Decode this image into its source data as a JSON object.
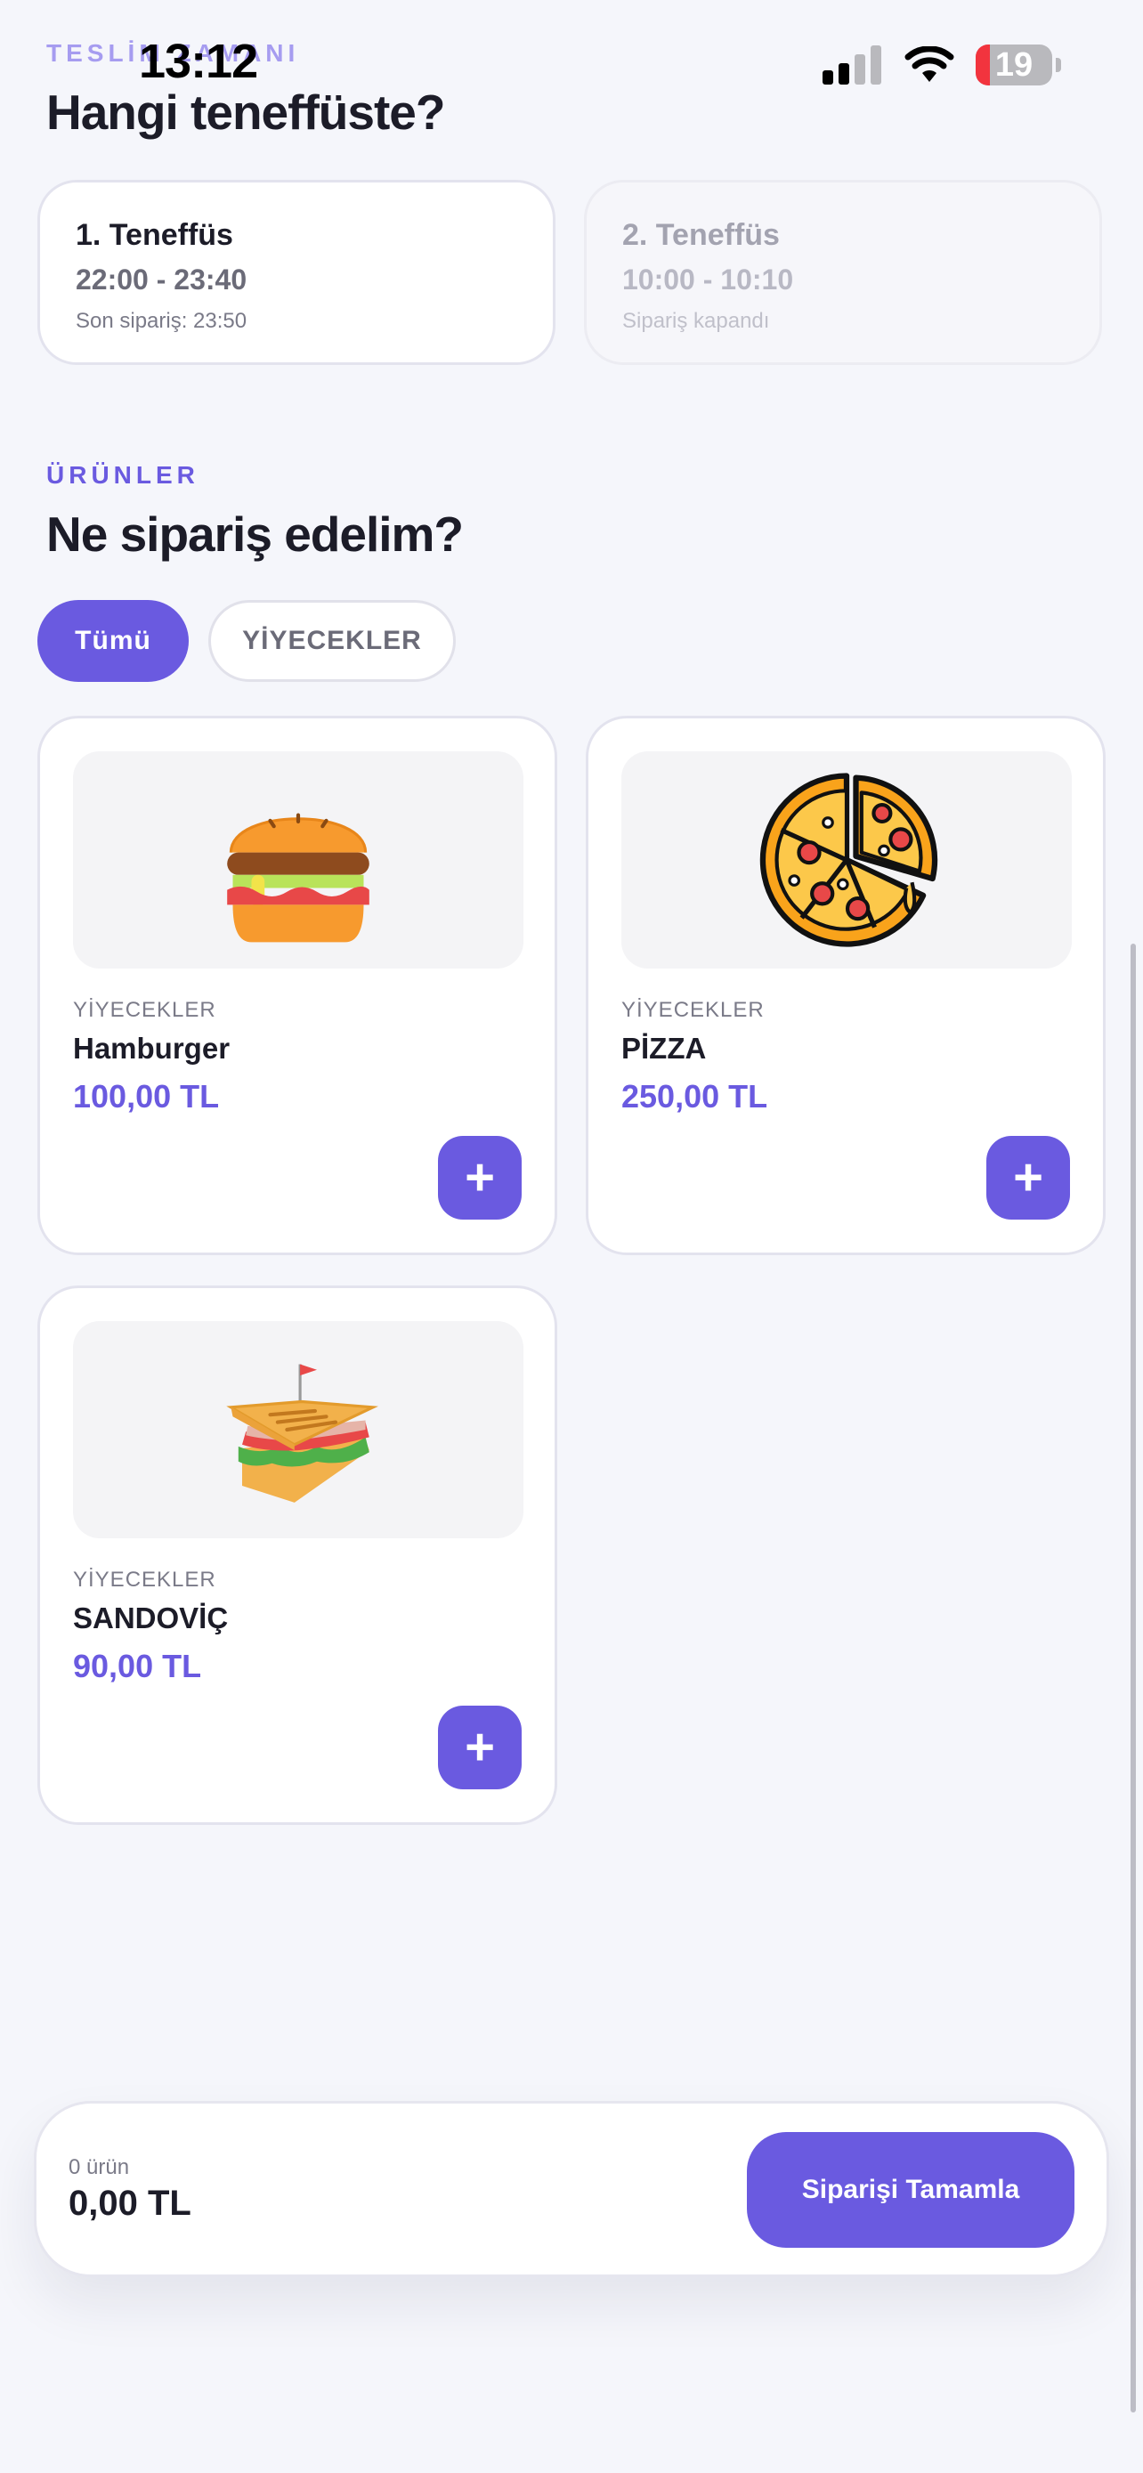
{
  "status_bar": {
    "time": "13:12",
    "battery": "19",
    "battery_level": 0.19
  },
  "delivery": {
    "label": "TESLİM ZAMANI",
    "title": "Hangi teneffüste?",
    "breaks": [
      {
        "name": "1. Teneffüs",
        "time": "22:00 - 23:40",
        "note": "Son sipariş: 23:50",
        "enabled": true
      },
      {
        "name": "2. Teneffüs",
        "time": "10:00 - 10:10",
        "note": "Sipariş kapandı",
        "enabled": false
      }
    ]
  },
  "products_section": {
    "label": "ÜRÜNLER",
    "title": "Ne sipariş edelim?",
    "filters": [
      {
        "label": "Tümü",
        "active": true
      },
      {
        "label": "YİYECEKLER",
        "active": false
      }
    ],
    "items": [
      {
        "category": "YİYECEKLER",
        "name": "Hamburger",
        "price": "100,00 TL",
        "icon": "burger-icon"
      },
      {
        "category": "YİYECEKLER",
        "name": "PİZZA",
        "price": "250,00 TL",
        "icon": "pizza-icon"
      },
      {
        "category": "YİYECEKLER",
        "name": "SANDOVİÇ",
        "price": "90,00 TL",
        "icon": "sandwich-icon"
      }
    ],
    "add_label": "+"
  },
  "order_bar": {
    "count": "0 ürün",
    "total": "0,00 TL",
    "button": "Siparişi Tamamla"
  },
  "colors": {
    "accent": "#6a5ae0",
    "background": "#f5f6fb"
  }
}
